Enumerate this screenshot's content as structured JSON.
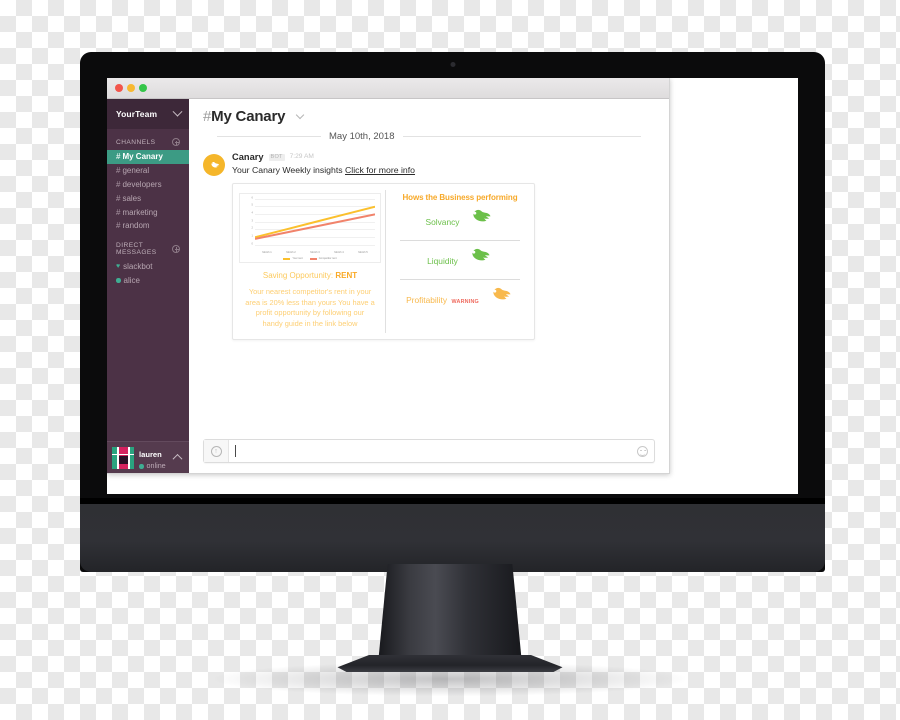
{
  "window": {
    "traffic_lights": [
      "close",
      "minimize",
      "zoom"
    ]
  },
  "sidebar": {
    "team_name": "YourTeam",
    "sections": [
      {
        "title": "CHANNELS"
      },
      {
        "title": "DIRECT MESSAGES"
      }
    ],
    "channels": [
      {
        "label": "My Canary",
        "active": true
      },
      {
        "label": "general",
        "active": false
      },
      {
        "label": "developers",
        "active": false
      },
      {
        "label": "sales",
        "active": false
      },
      {
        "label": "marketing",
        "active": false
      },
      {
        "label": "random",
        "active": false
      }
    ],
    "hash": "#",
    "direct_messages": [
      {
        "label": "slackbot",
        "presence": "heart"
      },
      {
        "label": "alice",
        "presence": "online"
      }
    ],
    "user": {
      "name": "lauren",
      "status": "online"
    },
    "colors": {
      "bg": "#4C3246",
      "team_bg": "#3D2839",
      "active": "#3C9B84",
      "footer_bg": "#553B4E"
    }
  },
  "main": {
    "channel_title": "My Canary",
    "channel_hash": "#",
    "date_divider": "May 10th, 2018",
    "message": {
      "author": "Canary",
      "bot_badge": "BOT",
      "time": "7:29 AM",
      "text": "Your Canary Weekly insights ",
      "link": "Click for more info"
    }
  },
  "card": {
    "saving_label": "Saving Opportunity: ",
    "saving_value": "RENT",
    "blurb": "Your nearest competitor's rent in your area is 20% less than yours You have a profit opportunity by following our handy guide in the link below",
    "performance_title": "Hows the Business performing",
    "metrics": [
      {
        "name": "Solvancy",
        "sub": "",
        "state": "good"
      },
      {
        "name": "Liquidity",
        "sub": "",
        "state": "good"
      },
      {
        "name": "Profitability",
        "sub": "WARNING",
        "state": "warn"
      }
    ],
    "colors": {
      "good": "#6CC04A",
      "warn": "#F8B94D",
      "warn_text": "#EF6A5E",
      "heading": "#F7A929",
      "body": "#FDCF74"
    }
  },
  "chart_data": {
    "type": "line",
    "title": "",
    "xlabel": "",
    "ylabel": "",
    "categories": [
      "Month 1",
      "Month 2",
      "Month 3",
      "Month 4",
      "Month 5"
    ],
    "ylim": [
      0,
      6
    ],
    "yticks": [
      0,
      1,
      2,
      3,
      4,
      5,
      6
    ],
    "grid": true,
    "legend_position": "bottom",
    "series": [
      {
        "name": "Your rent",
        "color": "#FBC02D",
        "values": [
          1.0,
          2.0,
          3.0,
          4.0,
          5.0
        ]
      },
      {
        "name": "Competitor rent",
        "color": "#F1836B",
        "values": [
          0.8,
          1.6,
          2.4,
          3.2,
          4.0
        ]
      }
    ]
  },
  "composer": {
    "placeholder": "",
    "value": "",
    "upload_icon": "plus-circle-icon",
    "emoji_icon": "smiley-icon"
  }
}
